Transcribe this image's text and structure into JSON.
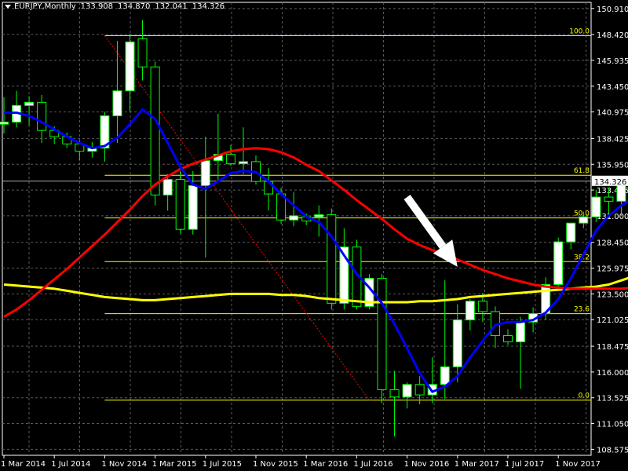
{
  "header": {
    "symbol": "EURJPY,Monthly",
    "open": "133.908",
    "high": "134.870",
    "low": "132.041",
    "close": "134.326"
  },
  "chart_data": {
    "type": "candlestick",
    "colors": {
      "background": "#000000",
      "grid": "#5a5a5a",
      "candle_bull_body": "#ffffff",
      "candle_bear_body": "#000000",
      "candle_outline": "#00ff00",
      "ma_fast": "#0000ff",
      "ma_slow": "#ff0000",
      "ma_long": "#ffff00",
      "fib": "#ffff00",
      "trendline": "#ff0000",
      "axis_text": "#ffffff",
      "arrow": "#ffffff"
    },
    "ylim": [
      108.0,
      151.5
    ],
    "y_ticks": [
      "150.910",
      "148.420",
      "145.935",
      "143.450",
      "140.975",
      "138.425",
      "135.950",
      "133.475",
      "131.000",
      "128.450",
      "125.975",
      "123.500",
      "121.025",
      "118.475",
      "116.000",
      "113.525",
      "111.050",
      "108.575"
    ],
    "y_tick_values": [
      150.91,
      148.42,
      145.935,
      143.45,
      140.975,
      138.425,
      135.95,
      133.475,
      131.0,
      128.45,
      125.975,
      123.5,
      121.025,
      118.475,
      116.0,
      113.525,
      111.05,
      108.575
    ],
    "x_ticks": [
      "1 Mar 2014",
      "1 Jul 2014",
      "1 Nov 2014",
      "1 Mar 2015",
      "1 Jul 2015",
      "1 Nov 2015",
      "1 Mar 2016",
      "1 Jul 2016",
      "1 Nov 2016",
      "1 Mar 2017",
      "1 Jul 2017",
      "1 Nov 2017"
    ],
    "x_tick_months": [
      0,
      4,
      8,
      12,
      16,
      20,
      24,
      28,
      32,
      36,
      40,
      44
    ],
    "first_month": "Feb 2014",
    "last_price_label": "134.326",
    "last_price": 134.326,
    "candles": [
      {
        "o": 139.8,
        "h": 142.4,
        "l": 138.9,
        "c": 140.0
      },
      {
        "o": 140.0,
        "h": 143.0,
        "l": 139.5,
        "c": 141.6
      },
      {
        "o": 141.6,
        "h": 142.5,
        "l": 139.7,
        "c": 141.9
      },
      {
        "o": 141.9,
        "h": 142.6,
        "l": 138.0,
        "c": 139.2
      },
      {
        "o": 139.2,
        "h": 139.6,
        "l": 137.9,
        "c": 138.6
      },
      {
        "o": 138.6,
        "h": 139.0,
        "l": 137.5,
        "c": 137.9
      },
      {
        "o": 137.9,
        "h": 138.2,
        "l": 136.3,
        "c": 137.2
      },
      {
        "o": 137.2,
        "h": 138.1,
        "l": 136.6,
        "c": 137.5
      },
      {
        "o": 137.5,
        "h": 141.0,
        "l": 136.2,
        "c": 140.6
      },
      {
        "o": 140.6,
        "h": 147.8,
        "l": 138.0,
        "c": 143.0
      },
      {
        "o": 143.0,
        "h": 148.5,
        "l": 141.0,
        "c": 147.7
      },
      {
        "o": 148.0,
        "h": 149.8,
        "l": 144.0,
        "c": 145.3
      },
      {
        "o": 145.3,
        "h": 145.8,
        "l": 132.0,
        "c": 133.0
      },
      {
        "o": 133.0,
        "h": 135.0,
        "l": 131.5,
        "c": 134.5
      },
      {
        "o": 134.5,
        "h": 135.3,
        "l": 129.3,
        "c": 129.7
      },
      {
        "o": 129.7,
        "h": 135.3,
        "l": 129.2,
        "c": 133.9
      },
      {
        "o": 133.9,
        "h": 138.6,
        "l": 127.0,
        "c": 136.3
      },
      {
        "o": 136.3,
        "h": 140.8,
        "l": 134.4,
        "c": 136.9
      },
      {
        "o": 136.9,
        "h": 137.8,
        "l": 135.8,
        "c": 136.0
      },
      {
        "o": 136.0,
        "h": 139.5,
        "l": 135.0,
        "c": 136.2
      },
      {
        "o": 136.2,
        "h": 136.8,
        "l": 134.0,
        "c": 134.3
      },
      {
        "o": 134.3,
        "h": 135.6,
        "l": 131.5,
        "c": 133.1
      },
      {
        "o": 133.1,
        "h": 133.7,
        "l": 130.2,
        "c": 130.6
      },
      {
        "o": 130.6,
        "h": 133.3,
        "l": 130.0,
        "c": 131.0
      },
      {
        "o": 130.9,
        "h": 131.2,
        "l": 130.1,
        "c": 130.5
      },
      {
        "o": 130.9,
        "h": 132.0,
        "l": 129.0,
        "c": 131.1
      },
      {
        "o": 131.1,
        "h": 131.7,
        "l": 122.0,
        "c": 122.6
      },
      {
        "o": 122.6,
        "h": 129.8,
        "l": 122.0,
        "c": 128.0
      },
      {
        "o": 128.0,
        "h": 128.7,
        "l": 122.0,
        "c": 122.3
      },
      {
        "o": 122.3,
        "h": 125.4,
        "l": 122.0,
        "c": 125.0
      },
      {
        "o": 125.0,
        "h": 125.4,
        "l": 113.0,
        "c": 114.3
      },
      {
        "o": 114.3,
        "h": 116.1,
        "l": 109.8,
        "c": 113.6
      },
      {
        "o": 113.6,
        "h": 115.0,
        "l": 112.5,
        "c": 114.8
      },
      {
        "o": 114.8,
        "h": 115.6,
        "l": 112.9,
        "c": 113.8
      },
      {
        "o": 113.8,
        "h": 117.4,
        "l": 113.0,
        "c": 114.8
      },
      {
        "o": 114.8,
        "h": 124.8,
        "l": 113.4,
        "c": 116.5
      },
      {
        "o": 116.5,
        "h": 122.5,
        "l": 115.0,
        "c": 121.0
      },
      {
        "o": 121.0,
        "h": 123.0,
        "l": 120.0,
        "c": 122.8
      },
      {
        "o": 122.8,
        "h": 123.6,
        "l": 120.8,
        "c": 121.8
      },
      {
        "o": 121.8,
        "h": 122.3,
        "l": 118.3,
        "c": 119.5
      },
      {
        "o": 119.5,
        "h": 120.1,
        "l": 118.6,
        "c": 118.9
      },
      {
        "o": 118.9,
        "h": 121.3,
        "l": 114.4,
        "c": 120.8
      },
      {
        "o": 120.8,
        "h": 122.2,
        "l": 119.8,
        "c": 121.6
      },
      {
        "o": 121.6,
        "h": 125.1,
        "l": 121.0,
        "c": 124.4
      },
      {
        "o": 124.4,
        "h": 128.9,
        "l": 124.0,
        "c": 128.5
      },
      {
        "o": 128.5,
        "h": 130.0,
        "l": 127.8,
        "c": 130.3
      },
      {
        "o": 130.3,
        "h": 131.4,
        "l": 129.8,
        "c": 130.9
      },
      {
        "o": 130.9,
        "h": 133.5,
        "l": 130.4,
        "c": 132.8
      },
      {
        "o": 132.8,
        "h": 133.7,
        "l": 131.2,
        "c": 132.4
      },
      {
        "o": 132.4,
        "h": 134.2,
        "l": 131.0,
        "c": 133.9
      },
      {
        "o": 133.908,
        "h": 134.87,
        "l": 132.041,
        "c": 134.326
      }
    ],
    "ma_fast": [
      140.9,
      140.9,
      140.6,
      140.0,
      139.3,
      138.6,
      138.0,
      137.5,
      137.7,
      138.5,
      139.8,
      141.2,
      140.3,
      138.0,
      135.7,
      134.0,
      133.6,
      134.3,
      135.1,
      135.3,
      135.2,
      134.3,
      133.1,
      132.0,
      130.9,
      130.4,
      129.0,
      127.2,
      125.4,
      124.1,
      122.6,
      120.6,
      118.3,
      115.9,
      114.1,
      114.6,
      115.6,
      117.4,
      119.0,
      120.5,
      120.8,
      120.8,
      121.0,
      121.7,
      123.0,
      125.0,
      127.3,
      129.6,
      131.0,
      132.0,
      132.7
    ],
    "ma_slow": [
      121.3,
      122.0,
      122.9,
      123.9,
      124.9,
      125.9,
      127.0,
      128.1,
      129.2,
      130.4,
      131.6,
      132.9,
      134.0,
      134.8,
      135.5,
      136.0,
      136.4,
      136.8,
      137.2,
      137.4,
      137.5,
      137.4,
      137.1,
      136.6,
      135.9,
      135.3,
      134.4,
      133.5,
      132.5,
      131.6,
      130.7,
      129.7,
      128.8,
      128.2,
      127.7,
      127.3,
      126.8,
      126.3,
      125.8,
      125.4,
      125.0,
      124.7,
      124.4,
      124.2,
      124.1,
      124.0,
      124.0,
      124.0,
      124.0,
      124.0,
      124.1
    ],
    "ma_long": [
      124.4,
      124.3,
      124.2,
      124.1,
      124.0,
      123.8,
      123.6,
      123.4,
      123.2,
      123.1,
      123.0,
      122.9,
      122.9,
      123.0,
      123.1,
      123.2,
      123.3,
      123.4,
      123.5,
      123.5,
      123.5,
      123.5,
      123.4,
      123.4,
      123.3,
      123.1,
      123.0,
      122.9,
      122.8,
      122.7,
      122.7,
      122.7,
      122.7,
      122.8,
      122.8,
      122.9,
      123.0,
      123.2,
      123.3,
      123.4,
      123.5,
      123.6,
      123.7,
      123.8,
      123.9,
      124.0,
      124.1,
      124.2,
      124.4,
      124.8,
      125.2
    ],
    "fib_levels": [
      {
        "label": "100.0",
        "price": 148.3,
        "start": 8
      },
      {
        "label": "61.8",
        "price": 134.9,
        "start": 8
      },
      {
        "label": "50.0",
        "price": 130.8,
        "start": 8
      },
      {
        "label": "38.2",
        "price": 126.6,
        "start": 8
      },
      {
        "label": "23.6",
        "price": 121.6,
        "start": 8
      },
      {
        "label": "0.0",
        "price": 113.3,
        "start": 8
      }
    ],
    "fib_trendline": {
      "from_month": 8,
      "from_price": 148.3,
      "to_month": 29,
      "to_price": 113.3
    },
    "arrow": {
      "from_month": 32,
      "from_price": 132.8,
      "to_month": 36,
      "to_price": 126.1
    }
  }
}
